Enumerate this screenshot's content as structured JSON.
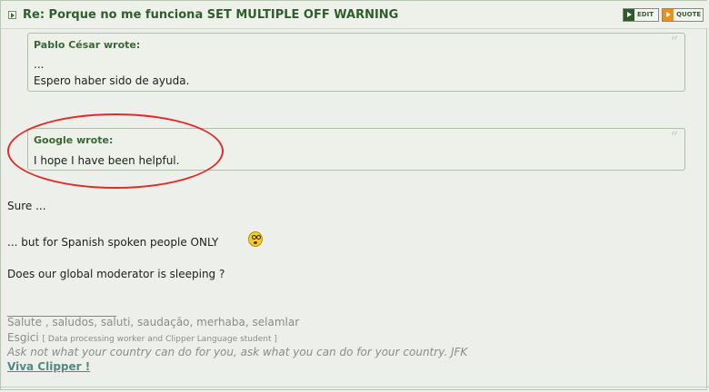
{
  "post": {
    "title": "Re: Porque no me funciona SET MULTIPLE OFF WARNING",
    "buttons": {
      "edit": "EDIT",
      "quote": "QUOTE"
    }
  },
  "quotes": [
    {
      "author": "Pablo César wrote:",
      "lines": [
        "...",
        "Espero haber sido de ayuda."
      ],
      "mark": "“"
    },
    {
      "author": "Google wrote:",
      "lines": [
        "I hope I have been helpful."
      ],
      "mark": "“"
    }
  ],
  "body": {
    "line1": "Sure ...",
    "line2": "... but for Spanish spoken people ONLY",
    "line3": "Does our global moderator is sleeping ?"
  },
  "signature": {
    "rule": "____________________",
    "line1": "Salute , saludos, saluti, saudação, merhaba, selamlar",
    "line2_name": "Esgici",
    "line2_tag": "[ Data processing worker and Clipper Language student ]",
    "line3": "Ask not what your country can do for you, ask what you can do for your country. JFK",
    "link": "Viva Clipper !"
  },
  "colors": {
    "accent_green": "#2f5e2c",
    "annotation_red": "#e12b2b",
    "quote_orange": "#ee8f16"
  },
  "icons": {
    "post_icon": "post-arrow-icon",
    "edit_icon": "edit-icon",
    "quote_icon": "quote-icon",
    "smiley": "embarrassed-smiley-icon"
  }
}
